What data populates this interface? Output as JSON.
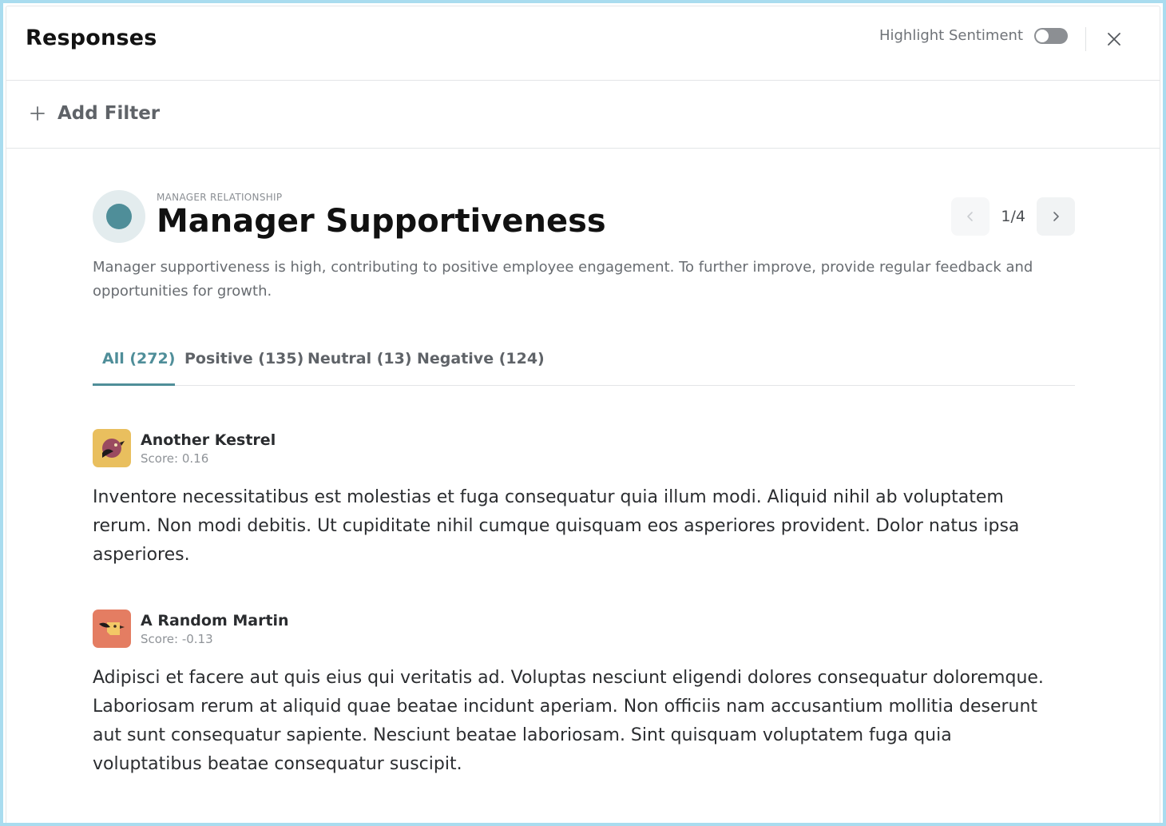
{
  "header": {
    "title": "Responses",
    "highlight_sentiment_label": "Highlight Sentiment",
    "highlight_sentiment_on": false
  },
  "filter": {
    "add_filter_label": "Add Filter"
  },
  "topic": {
    "category": "MANAGER RELATIONSHIP",
    "title": "Manager Supportiveness",
    "description": "Manager supportiveness is high, contributing to positive employee engagement. To further improve, provide regular feedback and opportunities for growth.",
    "pager": "1/4",
    "badge_color": "#4f8e99"
  },
  "tabs": [
    {
      "label": "All (272)",
      "active": true
    },
    {
      "label": "Positive (135)",
      "active": false
    },
    {
      "label": "Neutral (13)",
      "active": false
    },
    {
      "label": "Negative (124)",
      "active": false
    }
  ],
  "responses": [
    {
      "name": "Another Kestrel",
      "score": "Score: 0.16",
      "avatar_color": "#e9bf5e",
      "text": "Inventore necessitatibus est molestias et fuga consequatur quia illum modi. Aliquid nihil ab voluptatem rerum. Non modi debitis. Ut cupiditate nihil cumque quisquam eos asperiores provident. Dolor natus ipsa asperiores."
    },
    {
      "name": "A Random Martin",
      "score": "Score: -0.13",
      "avatar_color": "#e47d62",
      "text": "Adipisci et facere aut quis eius qui veritatis ad. Voluptas nesciunt eligendi dolores consequatur doloremque. Laboriosam rerum at aliquid quae beatae incidunt aperiam. Non officiis nam accusantium mollitia deserunt aut sunt consequatur sapiente. Nesciunt beatae laboriosam. Sint quisquam voluptatem fuga quia voluptatibus beatae consequatur suscipit."
    }
  ]
}
